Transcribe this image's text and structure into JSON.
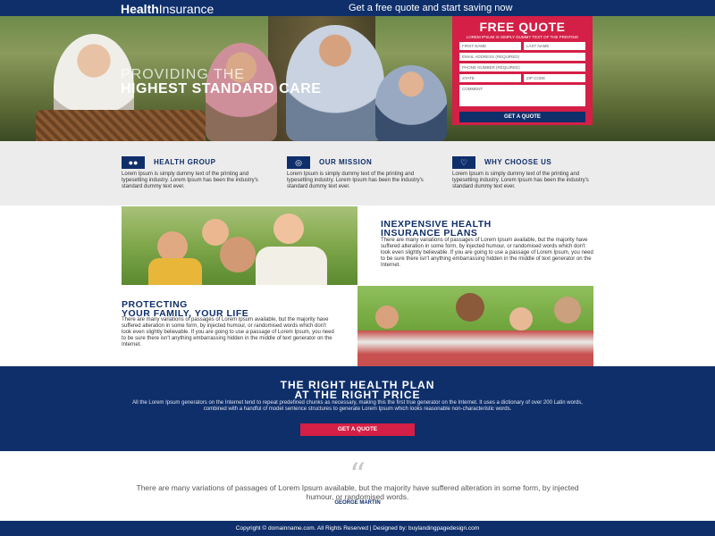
{
  "header": {
    "logo_bold": "Health",
    "logo_rest": "Insurance",
    "tagline": "Get a free quote and start saving now"
  },
  "hero": {
    "title_line1": "PROVIDING THE",
    "title_line2": "HIGHEST STANDARD CARE"
  },
  "quote_form": {
    "title": "FREE QUOTE",
    "subtitle": "LOREM IPSUM IS SIMPLY DUMMY TEXT OF THE PRINTING",
    "first_name": "FIRST NAME",
    "last_name": "LAST NAME",
    "email": "EMAIL ADDRESS (REQUIRED)",
    "phone": "PHONE NUMBER (REQUIRED)",
    "state": "STATE",
    "zip": "ZIP CODE",
    "comment": "COMMENT",
    "button": "GET A QUOTE"
  },
  "features": [
    {
      "icon": "group-icon",
      "title": "HEALTH GROUP",
      "text": "Lorem Ipsum is simply dummy text of the printing and typesetting industry. Lorem Ipsum has been the industry's standard dummy text ever."
    },
    {
      "icon": "mission-icon",
      "title": "OUR MISSION",
      "text": "Lorem Ipsum is simply dummy text of the printing and typesetting industry. Lorem Ipsum has been the industry's standard dummy text ever."
    },
    {
      "icon": "handshake-icon",
      "title": "WHY CHOOSE US",
      "text": "Lorem Ipsum is simply dummy text of the printing and typesetting industry. Lorem Ipsum has been the industry's standard dummy text ever."
    }
  ],
  "plans": {
    "title_line1": "INEXPENSIVE HEALTH",
    "title_line2": "INSURANCE PLANS",
    "text": "There are many variations of passages of Lorem Ipsum available, but the majority have suffered alteration in some form, by injected humour, or randomised words which don't look even slightly believable. If you are going to use a passage of Lorem Ipsum, you need to be sure there isn't anything embarrassing hidden in the middle of text generator on the Internet."
  },
  "protect": {
    "title_line1": "PROTECTING",
    "title_line2": "YOUR FAMILY, YOUR LIFE",
    "text": "There are many variations of passages of Lorem Ipsum available, but the majority have suffered alteration in some form, by injected humour, or randomised words which don't look even slightly believable. If you are going to use a passage of Lorem Ipsum, you need to be sure there isn't anything embarrassing hidden in the middle of text generator on the Internet."
  },
  "cta": {
    "title_line1": "THE RIGHT HEALTH PLAN",
    "title_line2": "AT THE RIGHT PRICE",
    "text": "All the Lorem Ipsum generators on the Internet tend to repeat predefined chunks as necessary, making this the first true generator on the Internet. It uses a dictionary of over 200 Latin words, combined with a handful of model sentence structures to generate Lorem Ipsum which looks reasonable non-characteristic words.",
    "button": "GET A QUOTE"
  },
  "testimonial": {
    "quote_mark": "“",
    "text": "There are many variations of passages of Lorem Ipsum available, but the majority have suffered alteration in some form, by injected humour, or randomised words.",
    "name": "GEORGE MARTIN"
  },
  "footer": {
    "text": "Copyright © domainname.com. All Rights Reserved  |  Designed by: buylandingpagedesign.com"
  },
  "colors": {
    "navy": "#0f2f6b",
    "red": "#d41f46",
    "light_gray": "#ececec"
  }
}
